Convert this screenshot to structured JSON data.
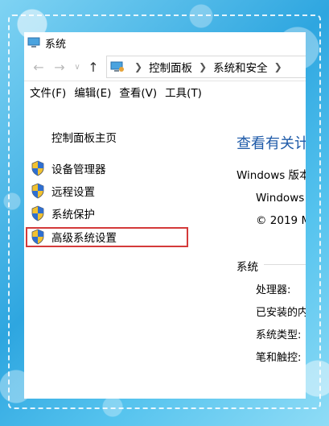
{
  "window": {
    "title": "系统"
  },
  "address_bar": {
    "crumbs": [
      "控制面板",
      "系统和安全"
    ]
  },
  "menu": [
    "文件(F)",
    "编辑(E)",
    "查看(V)",
    "工具(T)"
  ],
  "left_pane": {
    "home_link": "控制面板主页",
    "items": [
      "设备管理器",
      "远程设置",
      "系统保护",
      "高级系统设置"
    ],
    "highlighted_item": "高级系统设置",
    "highlight_color": "#d43a3a"
  },
  "right_pane": {
    "title": "查看有关计",
    "edition_label": "Windows 版本",
    "windows_name": "Windows",
    "copyright": "© 2019 M",
    "system_section": "系统",
    "rows": [
      "处理器:",
      "已安装的内",
      "系统类型:",
      "笔和触控:"
    ]
  },
  "colors": {
    "link_blue": "#1e5aa8",
    "background": "#3fb4e6"
  }
}
